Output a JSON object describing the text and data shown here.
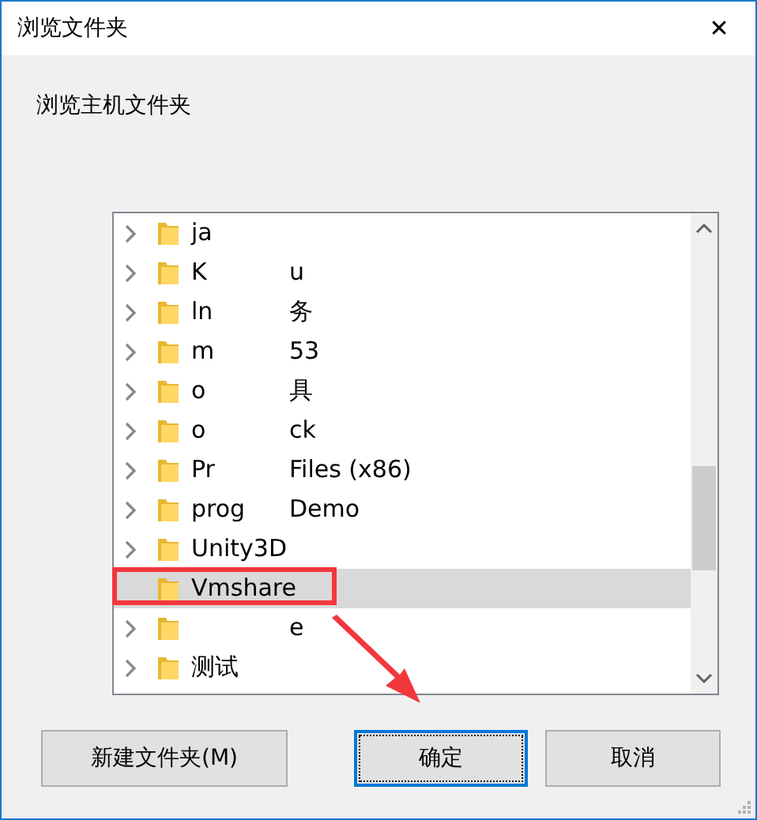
{
  "window": {
    "title": "浏览文件夹",
    "close": "✕"
  },
  "description": "浏览主机文件夹",
  "tree": {
    "items": [
      {
        "name_start": "ja",
        "expandable": true,
        "selected": false
      },
      {
        "name_start": "K",
        "name_end": "u",
        "expandable": true,
        "selected": false
      },
      {
        "name_start": "ln",
        "name_end": "务",
        "expandable": true,
        "selected": false
      },
      {
        "name_start": "m",
        "name_end": "53",
        "expandable": true,
        "selected": false
      },
      {
        "name_start": "o",
        "name_end": "具",
        "expandable": true,
        "selected": false
      },
      {
        "name_start": "o",
        "name_end": "ck",
        "expandable": true,
        "selected": false
      },
      {
        "name_start": "Pr",
        "name_end": "Files (x86)",
        "expandable": true,
        "selected": false
      },
      {
        "name_start": "prog",
        "name_end": "Demo",
        "expandable": true,
        "selected": false
      },
      {
        "name_start": "Unity3D",
        "expandable": true,
        "selected": false
      },
      {
        "name_start": "Vmshare",
        "expandable": false,
        "selected": true
      },
      {
        "name_end": "e",
        "expandable": true,
        "selected": false
      },
      {
        "name_start": "测试",
        "expandable": true,
        "selected": false
      }
    ]
  },
  "buttons": [
    {
      "label": "新建文件夹(M)",
      "default": false
    },
    {
      "label": "确定",
      "default": true
    },
    {
      "label": "取消",
      "default": false
    }
  ],
  "annotations": {
    "highlight_frame": true,
    "arrow": true
  }
}
